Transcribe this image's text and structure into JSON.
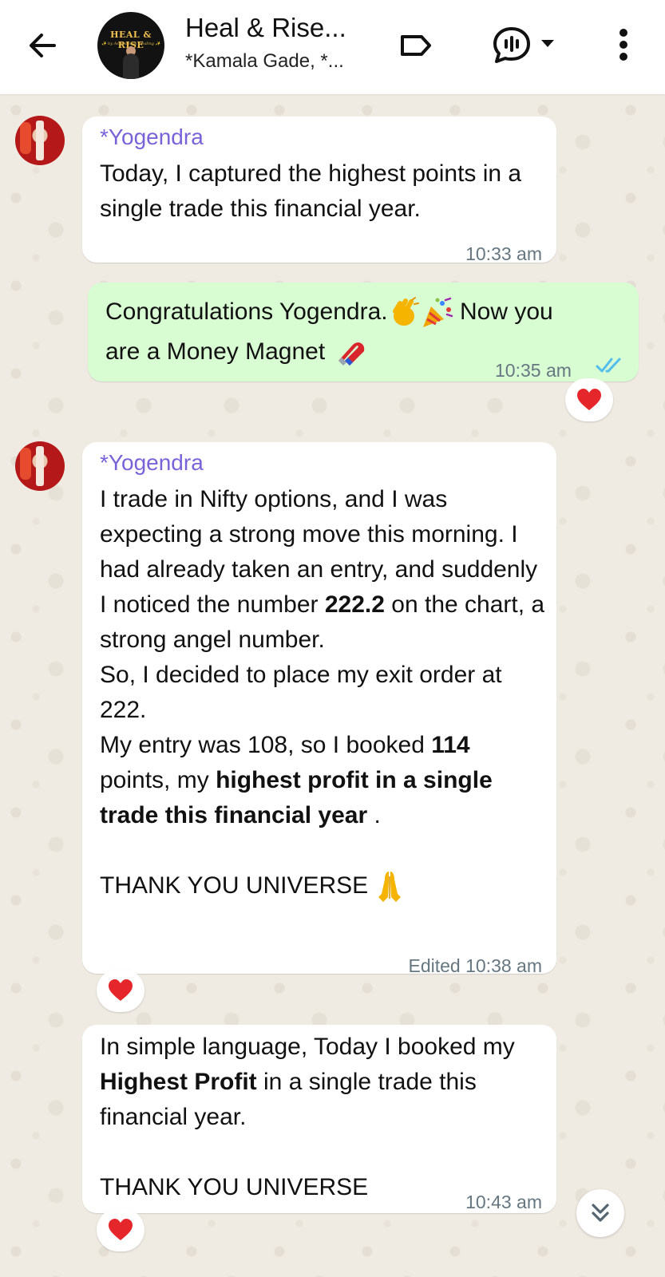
{
  "header": {
    "title": "Heal & Rise...",
    "subtitle": "*Kamala Gade, *...",
    "group_logo_text": "HEAL & RISE",
    "group_logo_sub": "✨ by Aspirations Healing ✨"
  },
  "messages": [
    {
      "sender": "*Yogendra",
      "text": "Today, I captured the highest points in a single trade this financial year.",
      "time": "10:33 am"
    },
    {
      "direction": "outgoing",
      "text_1": "Congratulations Yogendra.",
      "text_2": "Now you",
      "text_3": "are a Money Magnet",
      "time": "10:35 am",
      "reaction": "heart-icon"
    },
    {
      "sender": "*Yogendra",
      "p1": "I trade in Nifty options, and I was expecting a strong move this morning. I had already taken an entry, and suddenly I noticed the number",
      "p1_bold": "222.2",
      "p1_tail": "on the chart, a strong angel number.",
      "p2": "So, I decided to place my exit order at 222.",
      "p3_a": "My entry was 108, so I booked",
      "p3_bold1": "114",
      "p3_b": "points, my",
      "p3_bold2": "highest profit in a single trade this financial year",
      "p3_c": ".",
      "p4": "THANK YOU UNIVERSE",
      "time": "Edited 10:38 am",
      "reaction": "heart-icon"
    },
    {
      "p1_a": "In simple language, Today I booked my",
      "p1_bold": "Highest Profit",
      "p1_b": "in a single trade this financial year.",
      "p2": "THANK YOU UNIVERSE",
      "time": "10:43 am",
      "reaction": "heart-icon"
    }
  ],
  "colors": {
    "outgoing_bubble": "#d9fdd3",
    "sender_name": "#7a63d9",
    "read_ticks": "#53bdeb",
    "heart": "#e5262b"
  }
}
